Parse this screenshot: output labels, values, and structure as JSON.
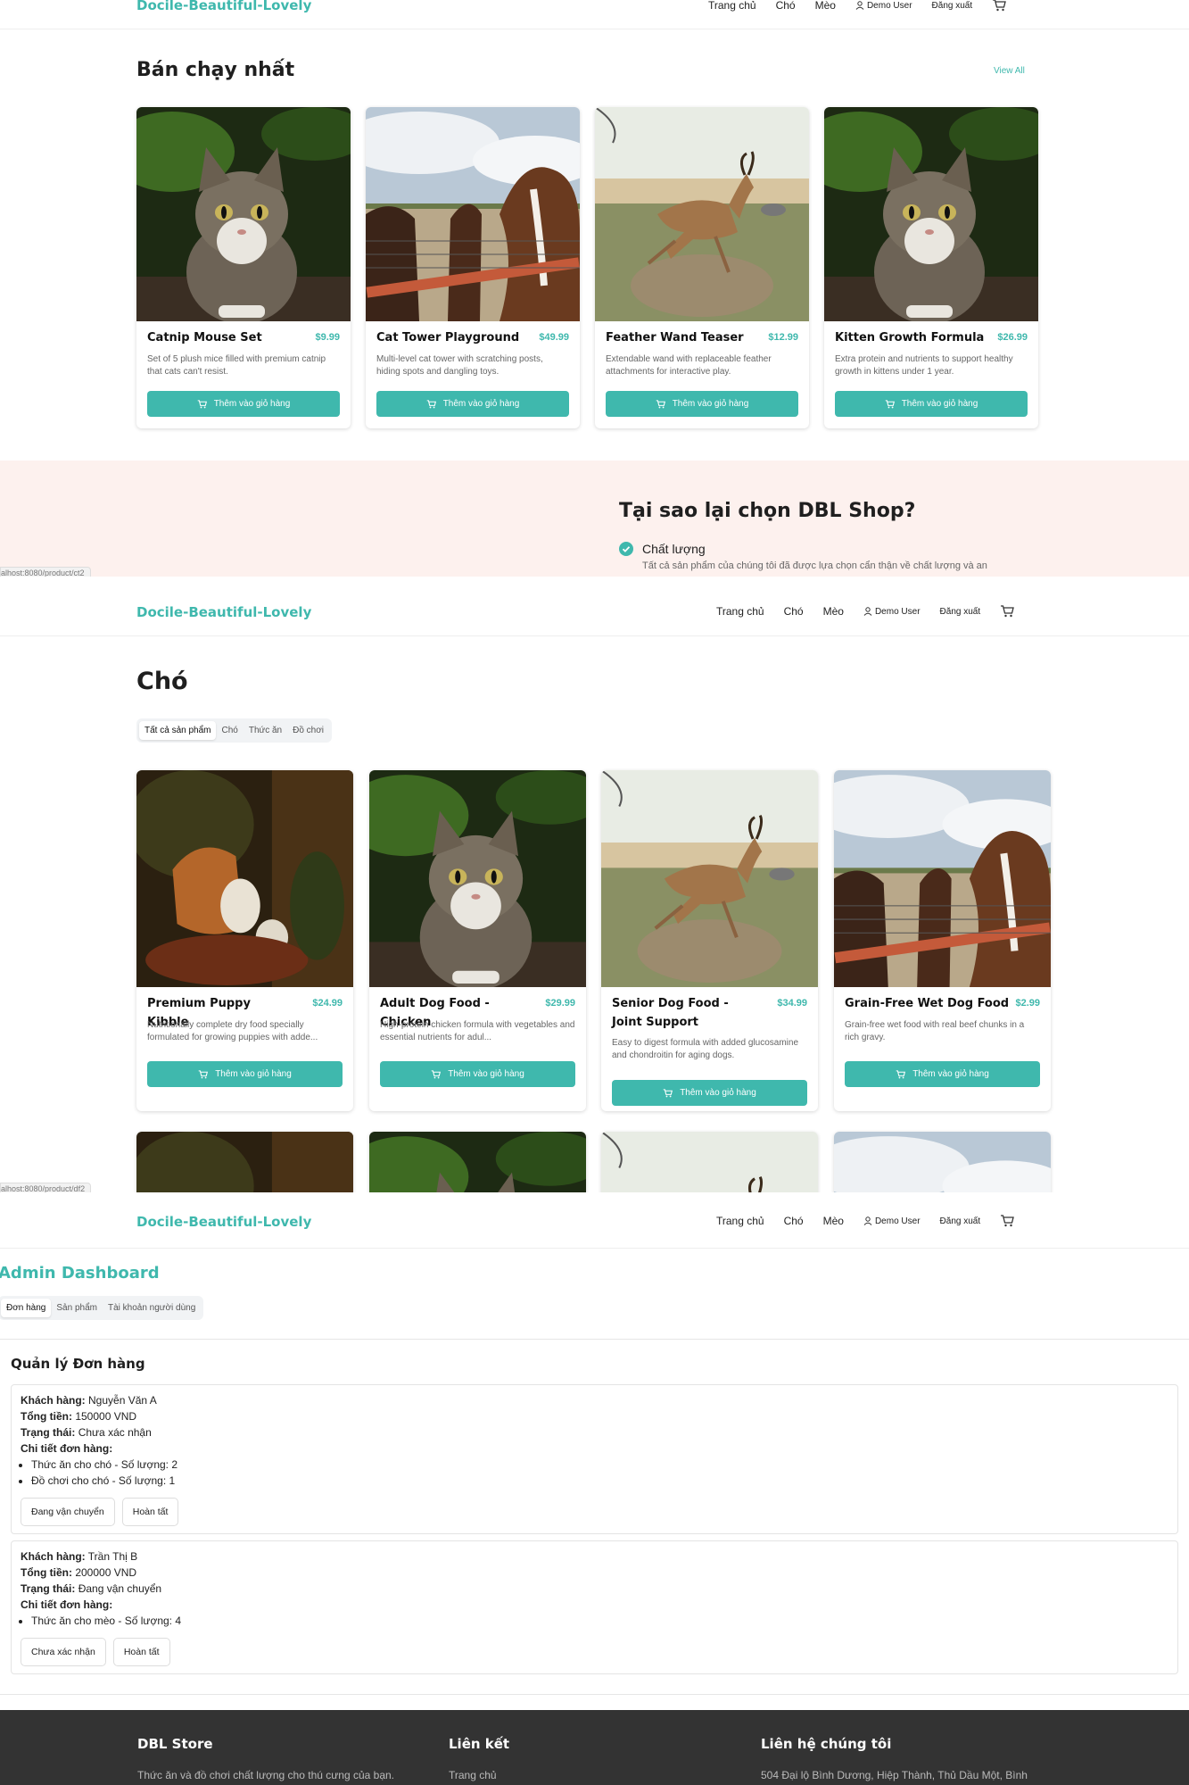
{
  "brand": "Docile-Beautiful-Lovely",
  "nav": {
    "home": "Trang chủ",
    "dog": "Chó",
    "cat": "Mèo",
    "user": "Demo User",
    "logout": "Đăng xuất"
  },
  "bestseller": {
    "title": "Bán chạy nhất",
    "view_all": "View All",
    "products": [
      {
        "name": "Catnip Mouse Set",
        "price": "$9.99",
        "desc": "Set of 5 plush mice filled with premium catnip that cats can't resist.",
        "image": "cat-photo"
      },
      {
        "name": "Cat Tower Playground",
        "price": "$49.99",
        "desc": "Multi-level cat tower with scratching posts, hiding spots and dangling toys.",
        "image": "horses-photo"
      },
      {
        "name": "Feather Wand Teaser",
        "price": "$12.99",
        "desc": "Extendable wand with replaceable feather attachments for interactive play.",
        "image": "antelope-photo"
      },
      {
        "name": "Kitten Growth Formula",
        "price": "$26.99",
        "desc": "Extra protein and nutrients to support healthy growth in kittens under 1 year.",
        "image": "cat-photo"
      }
    ]
  },
  "add_to_cart": "Thêm vào giỏ hàng",
  "why": {
    "title": "Tại sao lại chọn DBL Shop?",
    "item_title": "Chất lượng",
    "item_desc": "Tất cả sản phẩm của chúng tôi đã được lựa chọn cẩn thận về chất lượng và an"
  },
  "status_urls": [
    "alhost:8080/product/ct2",
    "alhost:8080/product/df2"
  ],
  "dog_page": {
    "title": "Chó",
    "tabs": [
      "Tất cả sản phẩm",
      "Chó",
      "Thức ăn",
      "Đồ chơi"
    ],
    "products": [
      {
        "name": "Premium Puppy Kibble",
        "price": "$24.99",
        "desc": "Nutritionally complete dry food specially formulated for growing puppies with adde...",
        "image": "cats-painting"
      },
      {
        "name": "Adult Dog Food - Chicken",
        "price": "$29.99",
        "desc": "High-protein chicken formula with vegetables and essential nutrients for adul...",
        "image": "cat-photo"
      },
      {
        "name": "Senior Dog Food - Joint Support",
        "price": "$34.99",
        "desc": "Easy to digest formula with added glucosamine and chondroitin for aging dogs.",
        "image": "antelope-photo"
      },
      {
        "name": "Grain-Free Wet Dog Food",
        "price": "$2.99",
        "desc": "Grain-free wet food with real beef chunks in a rich gravy.",
        "image": "horses-photo"
      }
    ]
  },
  "admin": {
    "title": "Admin Dashboard",
    "tabs": [
      "Đơn hàng",
      "Sản phẩm",
      "Tài khoản người dùng"
    ],
    "section_title": "Quản lý Đơn hàng",
    "labels": {
      "customer": "Khách hàng:",
      "total": "Tổng tiền:",
      "status": "Trạng thái:",
      "details": "Chi tiết đơn hàng:"
    },
    "orders": [
      {
        "customer": "Nguyễn Văn A",
        "total": "150000 VND",
        "status": "Chưa xác nhận",
        "items": [
          "Thức ăn cho chó - Số lượng: 2",
          "Đồ chơi cho chó - Số lượng: 1"
        ],
        "actions": [
          "Đang vận chuyển",
          "Hoàn tất"
        ]
      },
      {
        "customer": "Trần Thị B",
        "total": "200000 VND",
        "status": "Đang vận chuyển",
        "items": [
          "Thức ăn cho mèo - Số lượng: 4"
        ],
        "actions": [
          "Chưa xác nhận",
          "Hoàn tất"
        ]
      }
    ]
  },
  "footer": {
    "col1_title": "DBL Store",
    "col1_text": "Thức ăn và đồ chơi chất lượng cho thú cưng của bạn.",
    "col2_title": "Liên kết",
    "col2_link": "Trang chủ",
    "col3_title": "Liên hệ chúng tôi",
    "col3_text": "504 Đại lộ Bình Dương, Hiệp Thành, Thủ Dầu Một, Bình"
  },
  "colors": {
    "accent": "#3fb8ad",
    "why_bg": "#fdf1ee",
    "footer_bg": "#333333"
  }
}
